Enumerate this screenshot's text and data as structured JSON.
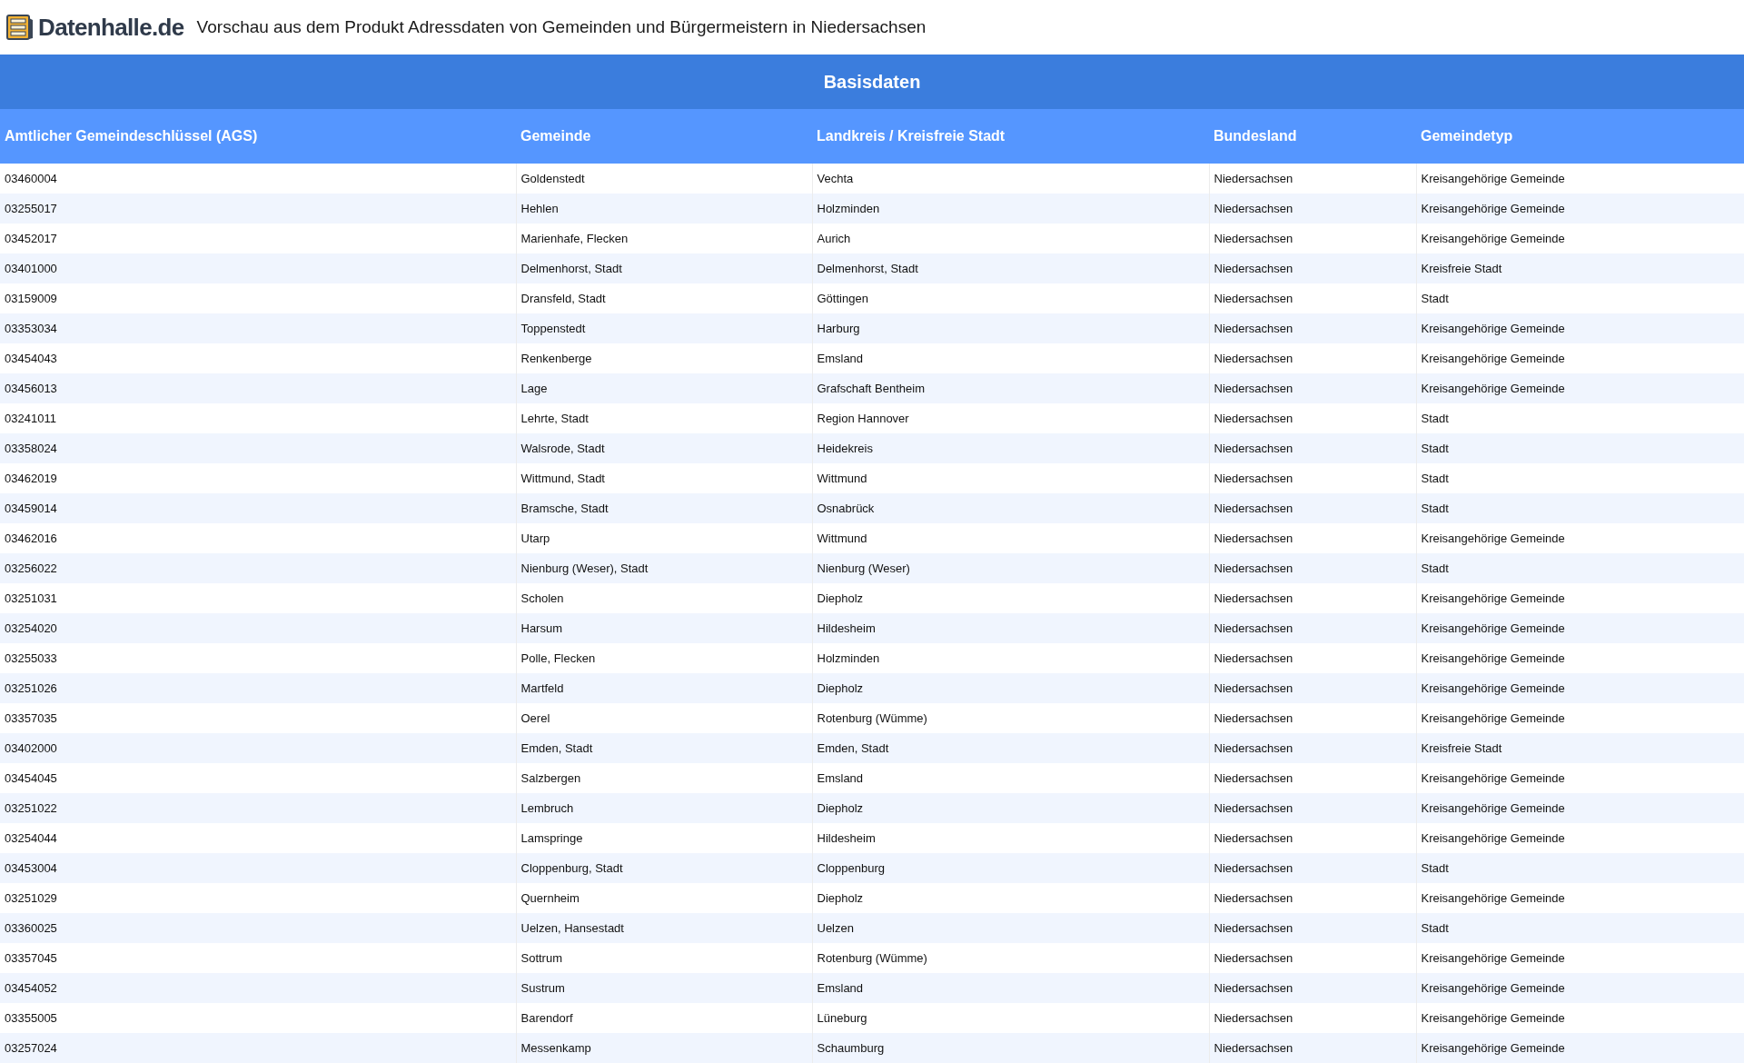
{
  "header": {
    "logo_text": "Datenhalle.de",
    "title": "Vorschau aus dem Produkt Adressdaten von Gemeinden und Bürgermeistern in Niedersachsen"
  },
  "table": {
    "group_heading": "Basisdaten",
    "columns": [
      "Amtlicher Gemeindeschlüssel (AGS)",
      "Gemeinde",
      "Landkreis / Kreisfreie Stadt",
      "Bundesland",
      "Gemeindetyp"
    ],
    "rows": [
      [
        "03460004",
        "Goldenstedt",
        "Vechta",
        "Niedersachsen",
        "Kreisangehörige Gemeinde"
      ],
      [
        "03255017",
        "Hehlen",
        "Holzminden",
        "Niedersachsen",
        "Kreisangehörige Gemeinde"
      ],
      [
        "03452017",
        "Marienhafe, Flecken",
        "Aurich",
        "Niedersachsen",
        "Kreisangehörige Gemeinde"
      ],
      [
        "03401000",
        "Delmenhorst, Stadt",
        "Delmenhorst, Stadt",
        "Niedersachsen",
        "Kreisfreie Stadt"
      ],
      [
        "03159009",
        "Dransfeld, Stadt",
        "Göttingen",
        "Niedersachsen",
        "Stadt"
      ],
      [
        "03353034",
        "Toppenstedt",
        "Harburg",
        "Niedersachsen",
        "Kreisangehörige Gemeinde"
      ],
      [
        "03454043",
        "Renkenberge",
        "Emsland",
        "Niedersachsen",
        "Kreisangehörige Gemeinde"
      ],
      [
        "03456013",
        "Lage",
        "Grafschaft Bentheim",
        "Niedersachsen",
        "Kreisangehörige Gemeinde"
      ],
      [
        "03241011",
        "Lehrte, Stadt",
        "Region Hannover",
        "Niedersachsen",
        "Stadt"
      ],
      [
        "03358024",
        "Walsrode, Stadt",
        "Heidekreis",
        "Niedersachsen",
        "Stadt"
      ],
      [
        "03462019",
        "Wittmund, Stadt",
        "Wittmund",
        "Niedersachsen",
        "Stadt"
      ],
      [
        "03459014",
        "Bramsche, Stadt",
        "Osnabrück",
        "Niedersachsen",
        "Stadt"
      ],
      [
        "03462016",
        "Utarp",
        "Wittmund",
        "Niedersachsen",
        "Kreisangehörige Gemeinde"
      ],
      [
        "03256022",
        "Nienburg (Weser), Stadt",
        "Nienburg (Weser)",
        "Niedersachsen",
        "Stadt"
      ],
      [
        "03251031",
        "Scholen",
        "Diepholz",
        "Niedersachsen",
        "Kreisangehörige Gemeinde"
      ],
      [
        "03254020",
        "Harsum",
        "Hildesheim",
        "Niedersachsen",
        "Kreisangehörige Gemeinde"
      ],
      [
        "03255033",
        "Polle, Flecken",
        "Holzminden",
        "Niedersachsen",
        "Kreisangehörige Gemeinde"
      ],
      [
        "03251026",
        "Martfeld",
        "Diepholz",
        "Niedersachsen",
        "Kreisangehörige Gemeinde"
      ],
      [
        "03357035",
        "Oerel",
        "Rotenburg (Wümme)",
        "Niedersachsen",
        "Kreisangehörige Gemeinde"
      ],
      [
        "03402000",
        "Emden, Stadt",
        "Emden, Stadt",
        "Niedersachsen",
        "Kreisfreie Stadt"
      ],
      [
        "03454045",
        "Salzbergen",
        "Emsland",
        "Niedersachsen",
        "Kreisangehörige Gemeinde"
      ],
      [
        "03251022",
        "Lembruch",
        "Diepholz",
        "Niedersachsen",
        "Kreisangehörige Gemeinde"
      ],
      [
        "03254044",
        "Lamspringe",
        "Hildesheim",
        "Niedersachsen",
        "Kreisangehörige Gemeinde"
      ],
      [
        "03453004",
        "Cloppenburg, Stadt",
        "Cloppenburg",
        "Niedersachsen",
        "Stadt"
      ],
      [
        "03251029",
        "Quernheim",
        "Diepholz",
        "Niedersachsen",
        "Kreisangehörige Gemeinde"
      ],
      [
        "03360025",
        "Uelzen, Hansestadt",
        "Uelzen",
        "Niedersachsen",
        "Stadt"
      ],
      [
        "03357045",
        "Sottrum",
        "Rotenburg (Wümme)",
        "Niedersachsen",
        "Kreisangehörige Gemeinde"
      ],
      [
        "03454052",
        "Sustrum",
        "Emsland",
        "Niedersachsen",
        "Kreisangehörige Gemeinde"
      ],
      [
        "03355005",
        "Barendorf",
        "Lüneburg",
        "Niedersachsen",
        "Kreisangehörige Gemeinde"
      ],
      [
        "03257024",
        "Messenkamp",
        "Schaumburg",
        "Niedersachsen",
        "Kreisangehörige Gemeinde"
      ]
    ]
  }
}
